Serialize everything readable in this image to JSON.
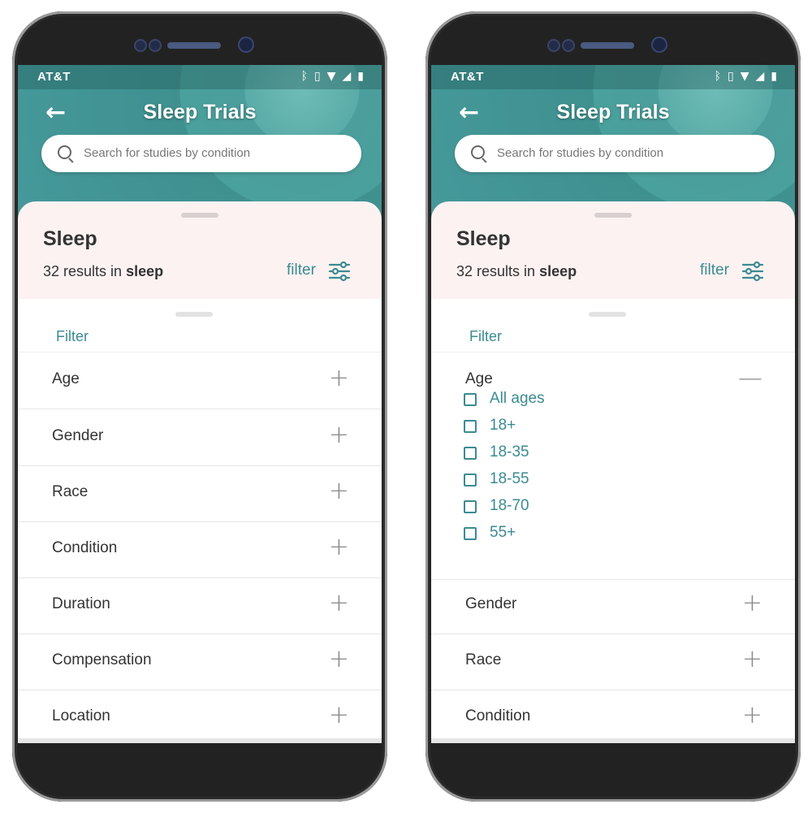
{
  "screens": [
    {
      "status": {
        "carrier": "AT&T",
        "icons": [
          "bluetooth-icon",
          "vibrate-icon",
          "wifi-icon",
          "signal-icon",
          "battery-icon"
        ]
      },
      "header": {
        "title": "Sleep Trials",
        "back_icon": "arrow-left-icon"
      },
      "search": {
        "placeholder": "Search for studies by condition",
        "icon": "search-icon"
      },
      "category": {
        "title": "Sleep",
        "results_prefix": "32 results in",
        "results_term": "sleep",
        "filter_label": "filter",
        "filter_icon": "sliders-icon"
      },
      "panel": {
        "title": "Filter"
      },
      "filters": [
        {
          "label": "Age",
          "toggle": "+"
        },
        {
          "label": "Gender",
          "toggle": "+"
        },
        {
          "label": "Race",
          "toggle": "+"
        },
        {
          "label": "Condition",
          "toggle": "+"
        },
        {
          "label": "Duration",
          "toggle": "+"
        },
        {
          "label": "Compensation",
          "toggle": "+"
        },
        {
          "label": "Location",
          "toggle": "+"
        }
      ]
    },
    {
      "status": {
        "carrier": "AT&T",
        "icons": [
          "bluetooth-icon",
          "vibrate-icon",
          "wifi-icon",
          "signal-icon",
          "battery-icon"
        ]
      },
      "header": {
        "title": "Sleep Trials",
        "back_icon": "arrow-left-icon"
      },
      "search": {
        "placeholder": "Search for studies by condition",
        "icon": "search-icon"
      },
      "category": {
        "title": "Sleep",
        "results_prefix": "32 results in",
        "results_term": "sleep",
        "filter_label": "filter",
        "filter_icon": "sliders-icon"
      },
      "panel": {
        "title": "Filter"
      },
      "filters": [
        {
          "label": "Age",
          "toggle": "—",
          "expanded": true,
          "options": [
            "All ages",
            "18+",
            "18-35",
            "18-55",
            "18-70",
            "55+"
          ]
        },
        {
          "label": "Gender",
          "toggle": "+"
        },
        {
          "label": "Race",
          "toggle": "+"
        },
        {
          "label": "Condition",
          "toggle": "+"
        }
      ]
    }
  ],
  "colors": {
    "accent": "#3b8b92",
    "header": "#46999a",
    "sheet": "#fdf2f2"
  }
}
